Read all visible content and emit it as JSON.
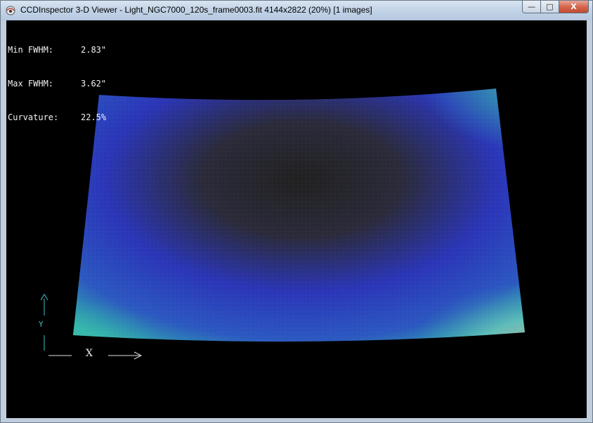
{
  "window": {
    "title": "CCDInspector 3-D Viewer - Light_NGC7000_120s_frame0003.fit 4144x2822 (20%)  [1 images]",
    "buttons": {
      "minimize": "—",
      "maximize": "□",
      "close": "X"
    }
  },
  "stats": {
    "min_fwhm_label": "Min FWHM:",
    "min_fwhm_value": "2.83\"",
    "max_fwhm_label": "Max FWHM:",
    "max_fwhm_value": "3.62\"",
    "curvature_label": "Curvature:",
    "curvature_value": "22.5%"
  },
  "axes": {
    "x_label": "X",
    "y_label": "Y"
  },
  "colors": {
    "low": "#202020",
    "mid": "#2a35b8",
    "high": "#2fb2a8",
    "peak": "#f08a8a",
    "axis": "#e0e0e0",
    "y_axis": "#3ec0c8"
  }
}
